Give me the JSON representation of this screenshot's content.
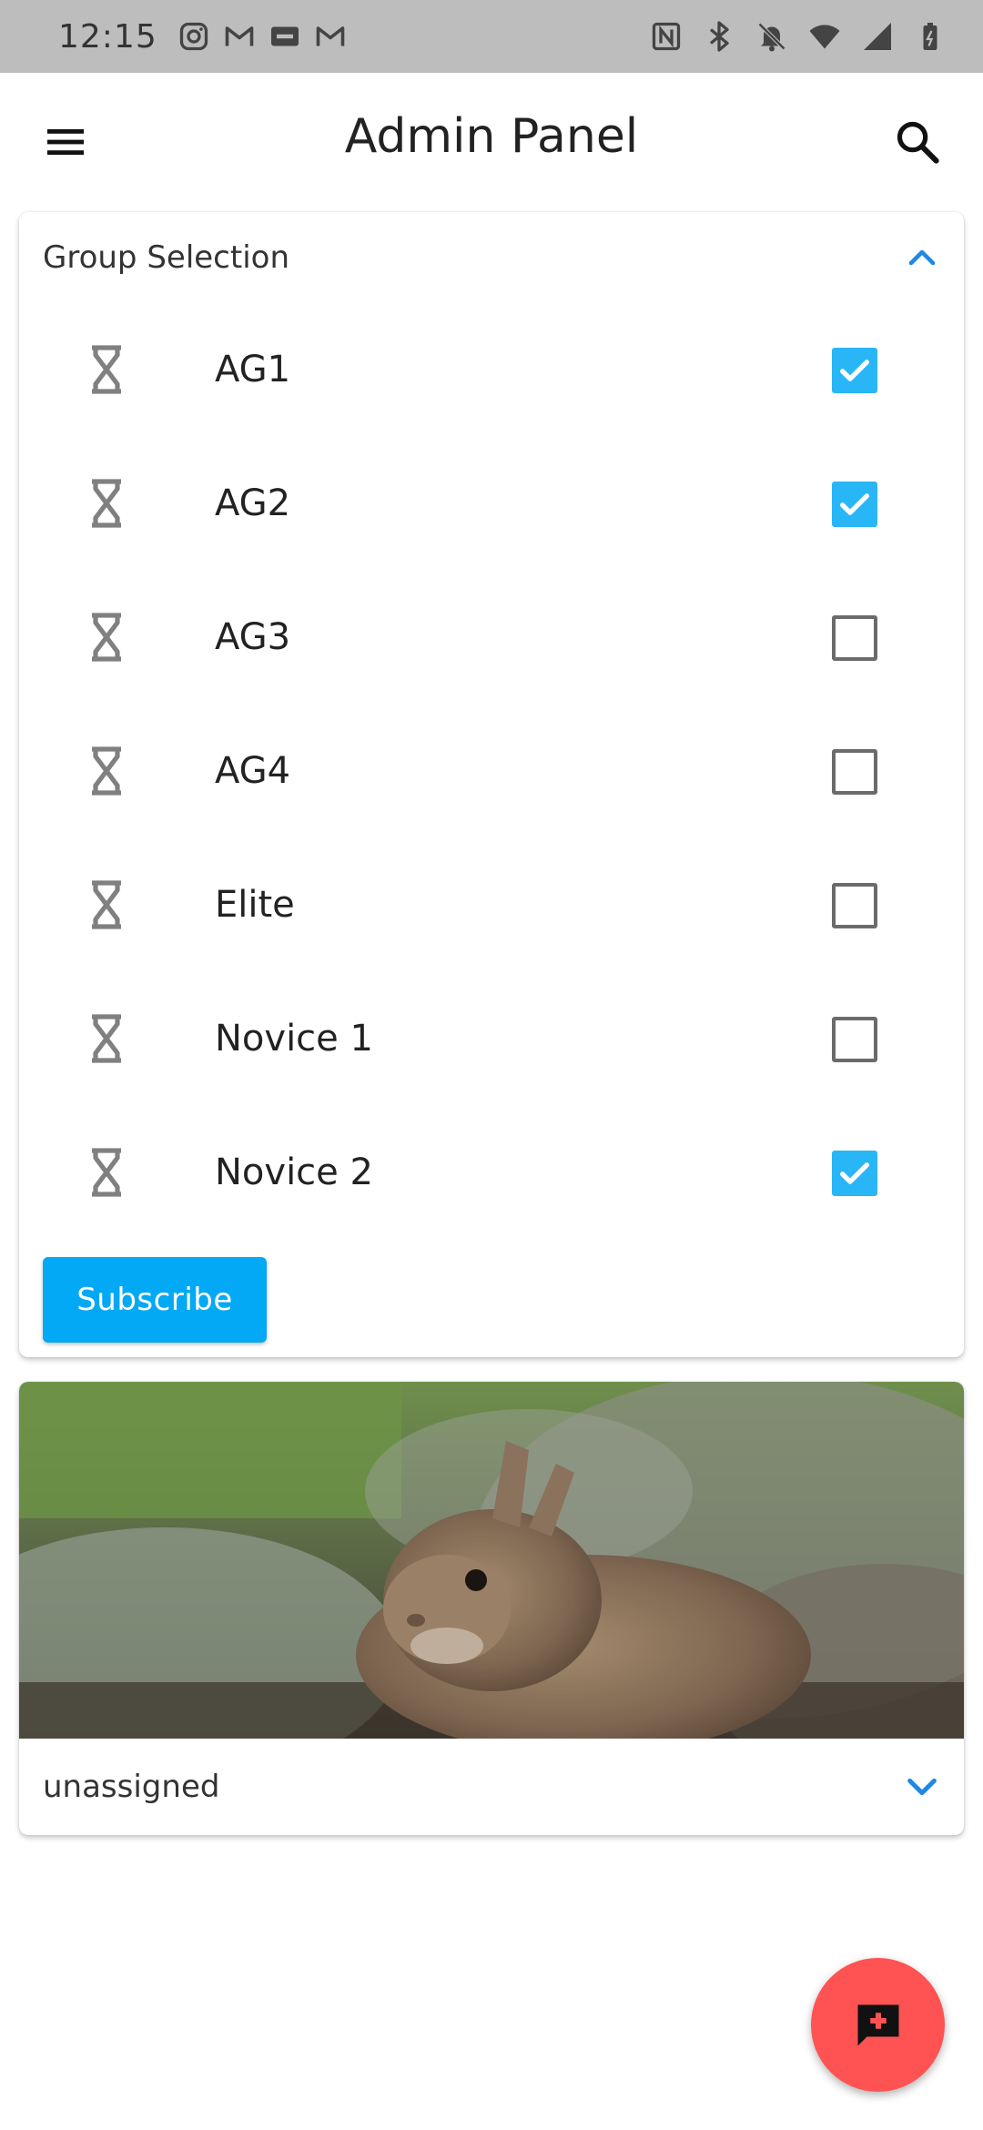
{
  "status_bar": {
    "time": "12:15",
    "left_icons": [
      "instagram-icon",
      "gmail-icon",
      "tsn-icon",
      "gmail-icon"
    ],
    "right_icons": [
      "nfc-icon",
      "bluetooth-icon",
      "do-not-disturb-icon",
      "wifi-icon",
      "signal-icon",
      "battery-icon"
    ]
  },
  "app_bar": {
    "title": "Admin Panel",
    "menu_icon": "menu-icon",
    "search_icon": "search-icon"
  },
  "group_selection": {
    "header": "Group Selection",
    "expanded": true,
    "groups": [
      {
        "label": "AG1",
        "checked": true
      },
      {
        "label": "AG2",
        "checked": true
      },
      {
        "label": "AG3",
        "checked": false
      },
      {
        "label": "AG4",
        "checked": false
      },
      {
        "label": "Elite",
        "checked": false
      },
      {
        "label": "Novice 1",
        "checked": false
      },
      {
        "label": "Novice 2",
        "checked": true
      }
    ],
    "subscribe_label": "Subscribe"
  },
  "media_card": {
    "image_subject": "rabbit-photo",
    "footer_label": "unassigned",
    "expanded": false
  },
  "fab": {
    "icon": "add-comment-icon"
  },
  "colors": {
    "accent": "#29b6f6",
    "button": "#03a9f4",
    "fab": "#ff5252",
    "status_bar": "#bdbdbd",
    "chevron": "#1e88e5"
  }
}
